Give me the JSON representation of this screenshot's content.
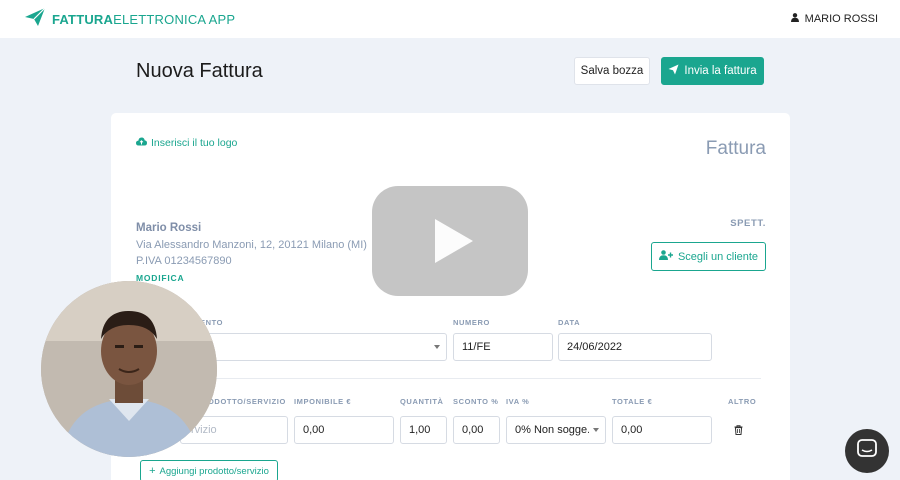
{
  "header": {
    "brand_bold": "FATTURA",
    "brand_light": "ELETTRONICA APP",
    "user_name": "MARIO ROSSI"
  },
  "page": {
    "title": "Nuova Fattura",
    "save_draft_label": "Salva bozza",
    "send_label": "Invia la fattura"
  },
  "invoice": {
    "upload_logo_label": "Inserisci il tuo logo",
    "doc_title": "Fattura",
    "seller": {
      "name": "Mario Rossi",
      "address": "Via Alessandro Manzoni, 12, 20121 Milano (MI)",
      "vat": "P.IVA 01234567890",
      "modify_label": "MODIFICA"
    },
    "recipient": {
      "label": "SPETT.",
      "choose_client_label": "Scegli un cliente"
    },
    "meta": {
      "document_label_partial": "ENTO",
      "number_label": "NUMERO",
      "number_value": "11/FE",
      "date_label": "DATA",
      "date_value": "24/06/2022"
    },
    "lines": {
      "columns": {
        "product_partial": "ODOTTO/SERVIZIO",
        "taxable": "IMPONIBILE €",
        "quantity": "QUANTITÀ",
        "discount": "SCONTO %",
        "vat": "IVA %",
        "total": "TOTALE €",
        "other": "ALTRO"
      },
      "row": {
        "product_placeholder_partial": "rvizio",
        "taxable_value": "0,00",
        "quantity_value": "1,00",
        "discount_value": "0,00",
        "vat_value": "0% Non sogge...",
        "total_value": "0,00"
      },
      "add_label": "Aggiungi prodotto/servizio"
    }
  },
  "colors": {
    "accent": "#1aa68f",
    "muted": "#8a9bb3",
    "background": "#eef2f8"
  },
  "icons": [
    "paper-plane-icon",
    "user-icon",
    "cloud-upload-icon",
    "user-plus-icon",
    "trash-icon",
    "plus-icon",
    "chat-icon",
    "youtube-play-icon"
  ]
}
